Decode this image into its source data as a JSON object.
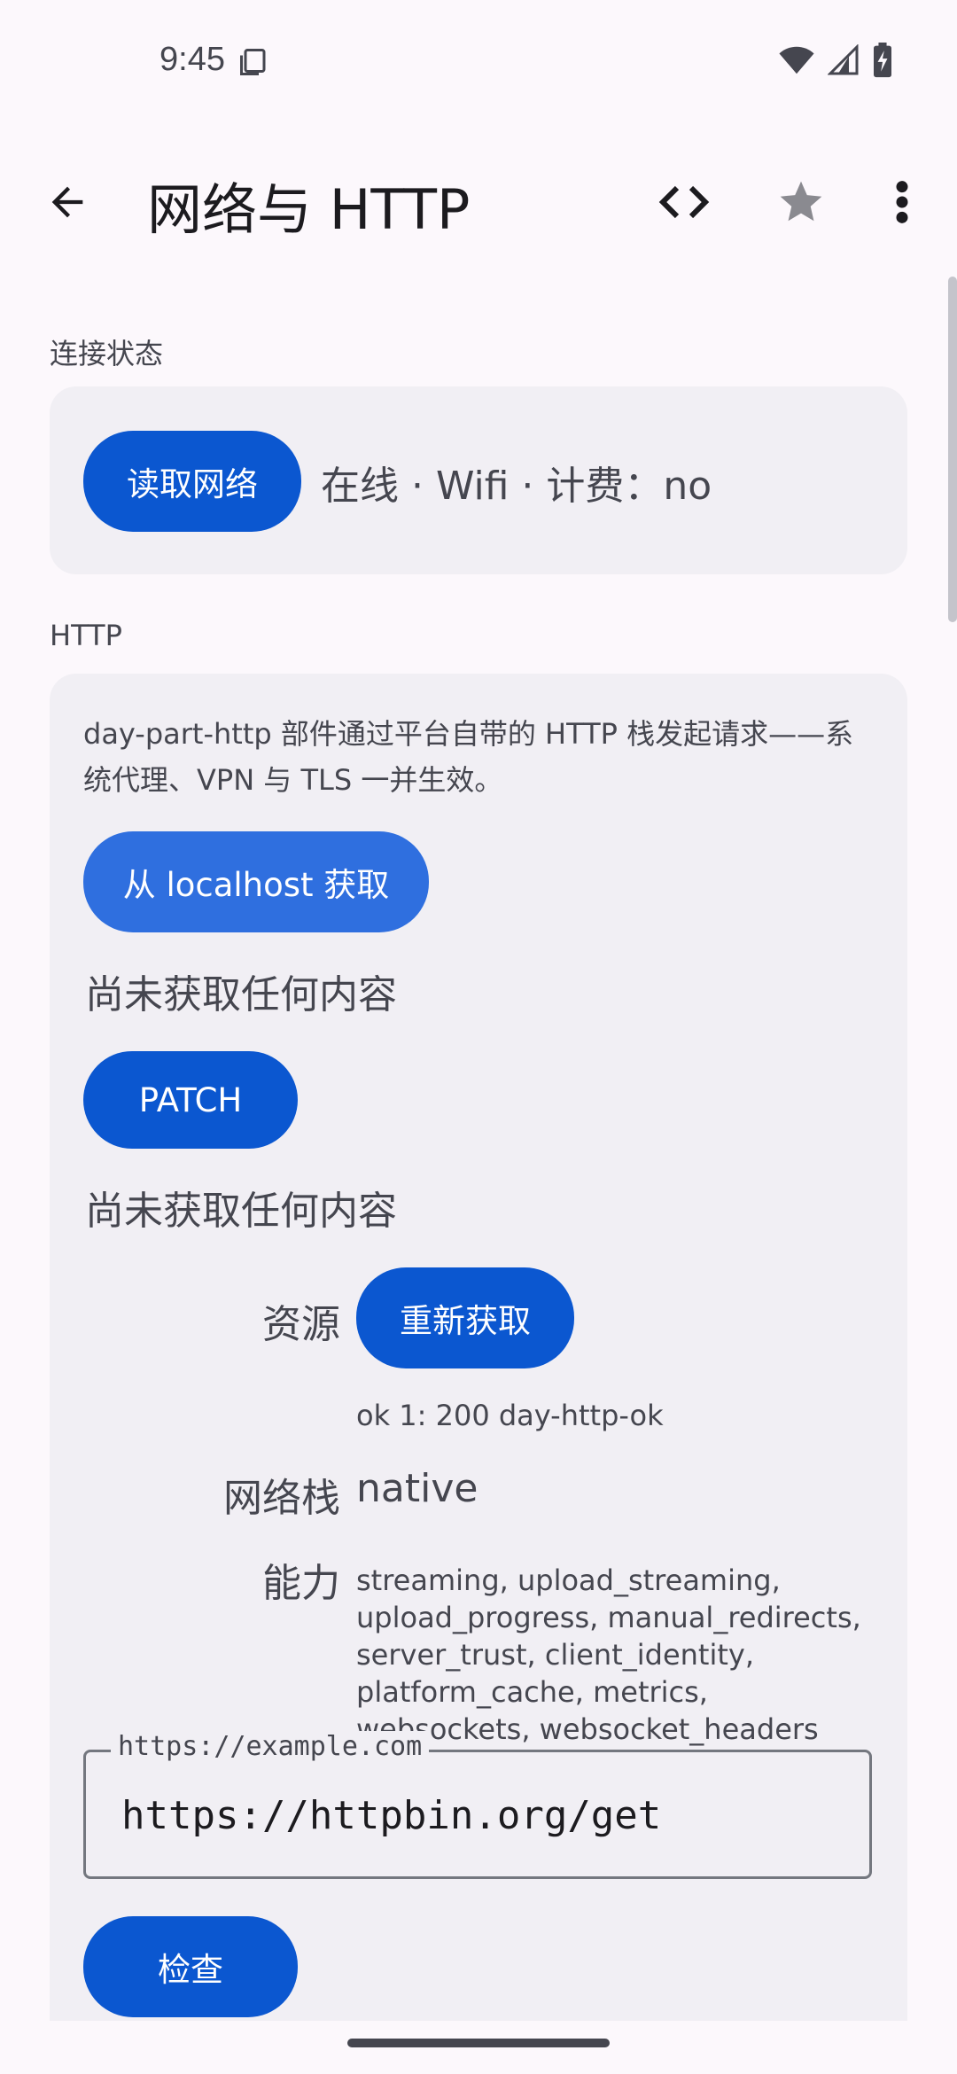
{
  "status_bar": {
    "time": "9:45"
  },
  "top_bar": {
    "title": "网络与 HTTP",
    "icons": [
      "back-arrow-icon",
      "code-icon",
      "star-icon",
      "more-vert-icon"
    ]
  },
  "connection": {
    "section_label": "连接状态",
    "read_button": "读取网络",
    "status_text": "在线 · Wifi · 计费：no"
  },
  "http": {
    "section_label": "HTTP",
    "description": "day-part-http 部件通过平台自带的 HTTP 栈发起请求——系统代理、VPN 与 TLS 一并生效。",
    "fetch_localhost_button": "从 localhost 获取",
    "fetch_localhost_result": "尚未获取任何内容",
    "patch_button": "PATCH",
    "patch_result": "尚未获取任何内容",
    "resource_label": "资源",
    "refetch_button": "重新获取",
    "resource_result": "ok 1: 200 day-http-ok",
    "stack_label": "网络栈",
    "stack_value": "native",
    "capabilities_label": "能力",
    "capabilities_value": "streaming, upload_streaming, upload_progress, manual_redirects, server_trust, client_identity, platform_cache, metrics, websockets, websocket_headers",
    "url_field_label": "https://example.com",
    "url_field_value": "https://httpbin.org/get",
    "check_button": "检查"
  },
  "colors": {
    "primary": "#0b57d0",
    "tonal": "#2f6fdf",
    "card_bg": "#f1eff4",
    "page_bg": "#fcf8fc"
  }
}
